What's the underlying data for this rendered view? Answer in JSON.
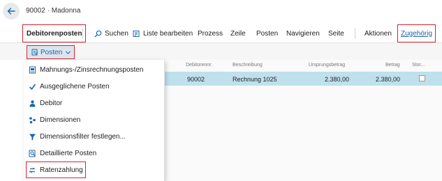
{
  "header": {
    "breadcrumb": "90002 · Madonna",
    "back_icon": "arrow-left-icon"
  },
  "actionbar": {
    "debitorenposten": "Debitorenposten",
    "suchen": "Suchen",
    "liste_bearbeiten": "Liste bearbeiten",
    "prozess": "Prozess",
    "zeile": "Zeile",
    "posten": "Posten",
    "navigieren": "Navigieren",
    "seite": "Seite",
    "aktionen": "Aktionen",
    "zugehoerig": "Zugehörig"
  },
  "dropdown_button": {
    "label": "Posten"
  },
  "menu": {
    "items": [
      {
        "label": "Mahnungs-/Zinsrechnungsposten",
        "icon": "document-list-icon"
      },
      {
        "label": "Ausgeglichene Posten",
        "icon": "checkmark-icon"
      },
      {
        "label": "Debitor",
        "icon": "person-icon"
      },
      {
        "label": "Dimensionen",
        "icon": "dimensions-icon"
      },
      {
        "label": "Dimensionsfilter festlegen...",
        "icon": "filter-icon"
      },
      {
        "label": "Detaillierte Posten",
        "icon": "detail-search-icon"
      },
      {
        "label": "Ratenzahlung",
        "icon": "installment-icon"
      }
    ]
  },
  "grid": {
    "columns": [
      "Debitorennr.",
      "Beschreibung",
      "Ursprungsbetrag",
      "Betrag",
      "Stor..."
    ],
    "rows": [
      {
        "debitorennr": "90002",
        "beschreibung": "Rechnung 1025",
        "ursprungsbetrag": "2.380,00",
        "betrag": "2.380,00",
        "storniert": false
      }
    ]
  },
  "colors": {
    "accent": "#1a66a8",
    "highlight_box": "#d9232e",
    "selected_row": "#bfe0ed"
  }
}
